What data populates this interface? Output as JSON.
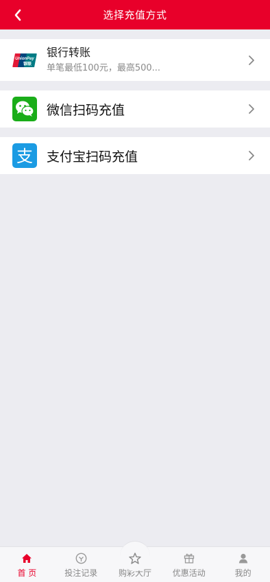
{
  "header": {
    "title": "选择充值方式",
    "back_icon": "chevron-left-icon"
  },
  "methods": [
    {
      "id": "bank",
      "title": "银行转账",
      "subtitle": "单笔最低100元，最高500...",
      "icon": "unionpay-icon",
      "logo_text": "UnionPay 银联"
    },
    {
      "id": "wechat",
      "title": "微信扫码充值",
      "icon": "wechat-icon"
    },
    {
      "id": "alipay",
      "title": "支付宝扫码充值",
      "icon": "alipay-icon",
      "logo_text": "支"
    }
  ],
  "tabbar": {
    "items": [
      {
        "label": "首 页",
        "icon": "home-icon",
        "active": true
      },
      {
        "label": "投注记录",
        "icon": "record-icon",
        "active": false
      },
      {
        "label": "购彩大厅",
        "icon": "star-icon",
        "active": false
      },
      {
        "label": "优惠活动",
        "icon": "gift-icon",
        "active": false
      },
      {
        "label": "我的",
        "icon": "user-icon",
        "active": false
      }
    ]
  },
  "colors": {
    "brand": "#e8002a",
    "background": "#ececf1",
    "wechat": "#1aad19",
    "alipay": "#1b9be3"
  }
}
